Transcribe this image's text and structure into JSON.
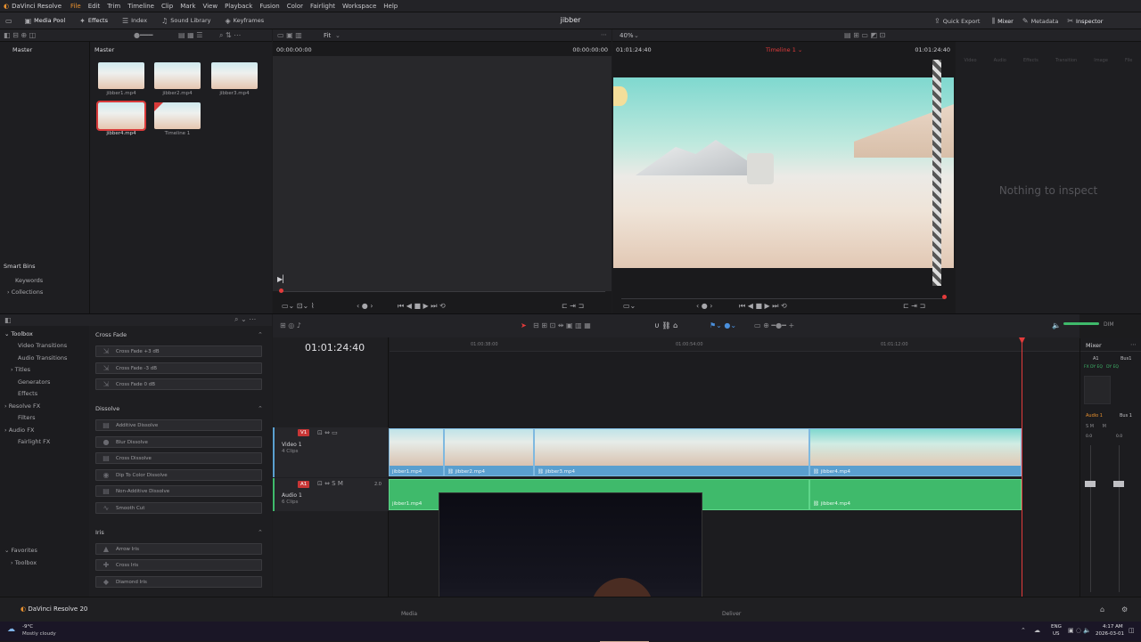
{
  "menubar": {
    "app_name": "DaVinci Resolve",
    "items": [
      "File",
      "Edit",
      "Trim",
      "Timeline",
      "Clip",
      "Mark",
      "View",
      "Playback",
      "Fusion",
      "Color",
      "Fairlight",
      "Workspace",
      "Help"
    ]
  },
  "toolbar": {
    "media_pool": "Media Pool",
    "effects": "Effects",
    "index": "Index",
    "sound_library": "Sound Library",
    "keyframes": "Keyframes",
    "project_title": "jibber",
    "quick_export": "Quick Export",
    "mixer": "Mixer",
    "metadata": "Metadata",
    "inspector": "Inspector"
  },
  "media_pool": {
    "bin_header": "Master",
    "grid_header": "Master",
    "clips": [
      "jibber1.mp4",
      "jibber2.mp4",
      "jibber3.mp4",
      "jibber4.mp4",
      "Timeline 1"
    ],
    "smart_bins_header": "Smart Bins",
    "smart_bins": [
      "Keywords",
      "Collections"
    ]
  },
  "source_viewer": {
    "zoom": "Fit",
    "timecode_left": "00:00:00:00",
    "timecode_right": "00:00:00:00"
  },
  "timeline_viewer": {
    "zoom": "40%",
    "timecode": "01:01:24:40",
    "timeline_name": "Timeline 1",
    "timecode_right": "01:01:24:40"
  },
  "inspector": {
    "tabs": [
      "Video",
      "Audio",
      "Effects",
      "Transition",
      "Image",
      "File"
    ],
    "empty_text": "Nothing to inspect"
  },
  "effects": {
    "toolbox_header": "Toolbox",
    "tree": [
      "Video Transitions",
      "Audio Transitions",
      "Titles",
      "Generators",
      "Effects",
      "Resolve FX",
      "Filters",
      "Audio FX",
      "Fairlight FX"
    ],
    "favorites_header": "Favorites",
    "favorites": [
      "Toolbox"
    ],
    "sections": [
      {
        "title": "Cross Fade",
        "items": [
          "Cross Fade +3 dB",
          "Cross Fade -3 dB",
          "Cross Fade 0 dB"
        ]
      },
      {
        "title": "Dissolve",
        "items": [
          "Additive Dissolve",
          "Blur Dissolve",
          "Cross Dissolve",
          "Dip To Color Dissolve",
          "Non-Additive Dissolve",
          "Smooth Cut"
        ]
      },
      {
        "title": "Iris",
        "items": [
          "Arrow Iris",
          "Cross Iris",
          "Diamond Iris"
        ]
      }
    ]
  },
  "timeline": {
    "timecode": "01:01:24:40",
    "ruler": [
      "01:00:38:00",
      "01:00:54:00",
      "01:01:12:00"
    ],
    "video_track": {
      "id": "V1",
      "name": "Video 1",
      "count": "4 Clips",
      "clips": [
        "jibber1.mp4",
        "jibber2.mp4",
        "jibber3.mp4",
        "jibber4.mp4"
      ]
    },
    "audio_track": {
      "id": "A1",
      "name": "Audio 1",
      "count": "6 Clips",
      "level": "2.0",
      "clips": [
        "jibber1.mp4",
        "jibber4.mp4"
      ]
    }
  },
  "mixer": {
    "header": "Mixer",
    "a1": "A1",
    "bus1": "Bus1",
    "audio1": "Audio 1",
    "bus1b": "Bus 1",
    "val_left": "0.0",
    "val_right": "0.0",
    "dim": "DIM"
  },
  "pages": {
    "media": "Media",
    "deliver": "Deliver"
  },
  "brand": "DaVinci Resolve 20",
  "taskbar": {
    "weather_temp": "-9°C",
    "weather_desc": "Mostly cloudy",
    "lang": "ENG",
    "region": "US",
    "time": "4:17 AM",
    "date": "2026-03-01"
  },
  "colors": {
    "accent": "#e9912f",
    "playhead": "#e33b3b",
    "video_clip": "#5a9fcf",
    "audio_clip": "#3fba6b"
  }
}
